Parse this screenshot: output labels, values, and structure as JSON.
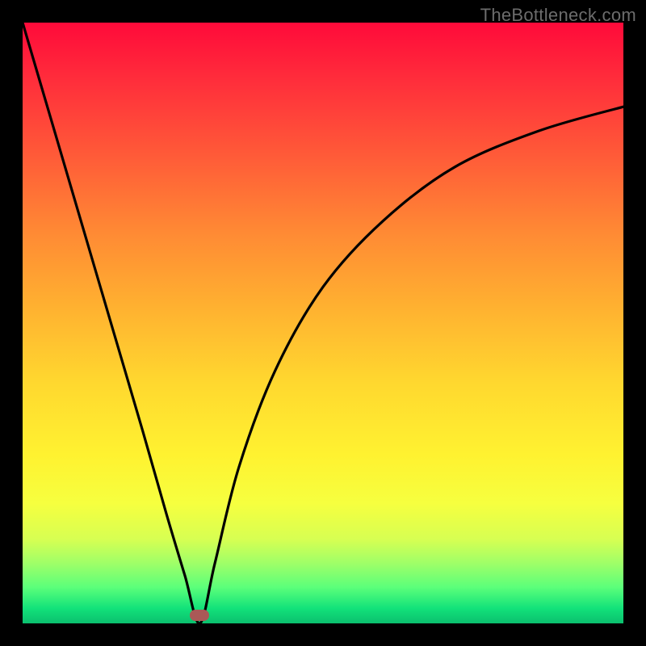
{
  "watermark": "TheBottleneck.com",
  "marker": {
    "x_frac": 0.295,
    "y_frac": 0.986
  },
  "colors": {
    "background": "#000000",
    "curve": "#000000",
    "marker": "#aa5957",
    "watermark": "#6c6c6c"
  },
  "chart_data": {
    "type": "line",
    "title": "",
    "xlabel": "",
    "ylabel": "",
    "xlim": [
      0,
      100
    ],
    "ylim": [
      0,
      100
    ],
    "legend": false,
    "grid": false,
    "annotations": [
      "TheBottleneck.com"
    ],
    "notes": "V-shaped bottleneck curve; minimum (≈0) near x≈29.5; left branch rises to ≈100 at x=0; right branch rises asymptotically toward ≈86 at x=100. Background is a vertical red→yellow→green gradient; y=0 (bottom) is best (green).",
    "series": [
      {
        "name": "bottleneck",
        "x": [
          0,
          5,
          10,
          15,
          20,
          24,
          27,
          29.5,
          32,
          36,
          42,
          50,
          60,
          72,
          86,
          100
        ],
        "values": [
          100,
          83,
          66,
          49,
          32,
          18,
          8,
          0,
          10,
          26,
          42,
          56,
          67,
          76,
          82,
          86
        ]
      }
    ]
  }
}
